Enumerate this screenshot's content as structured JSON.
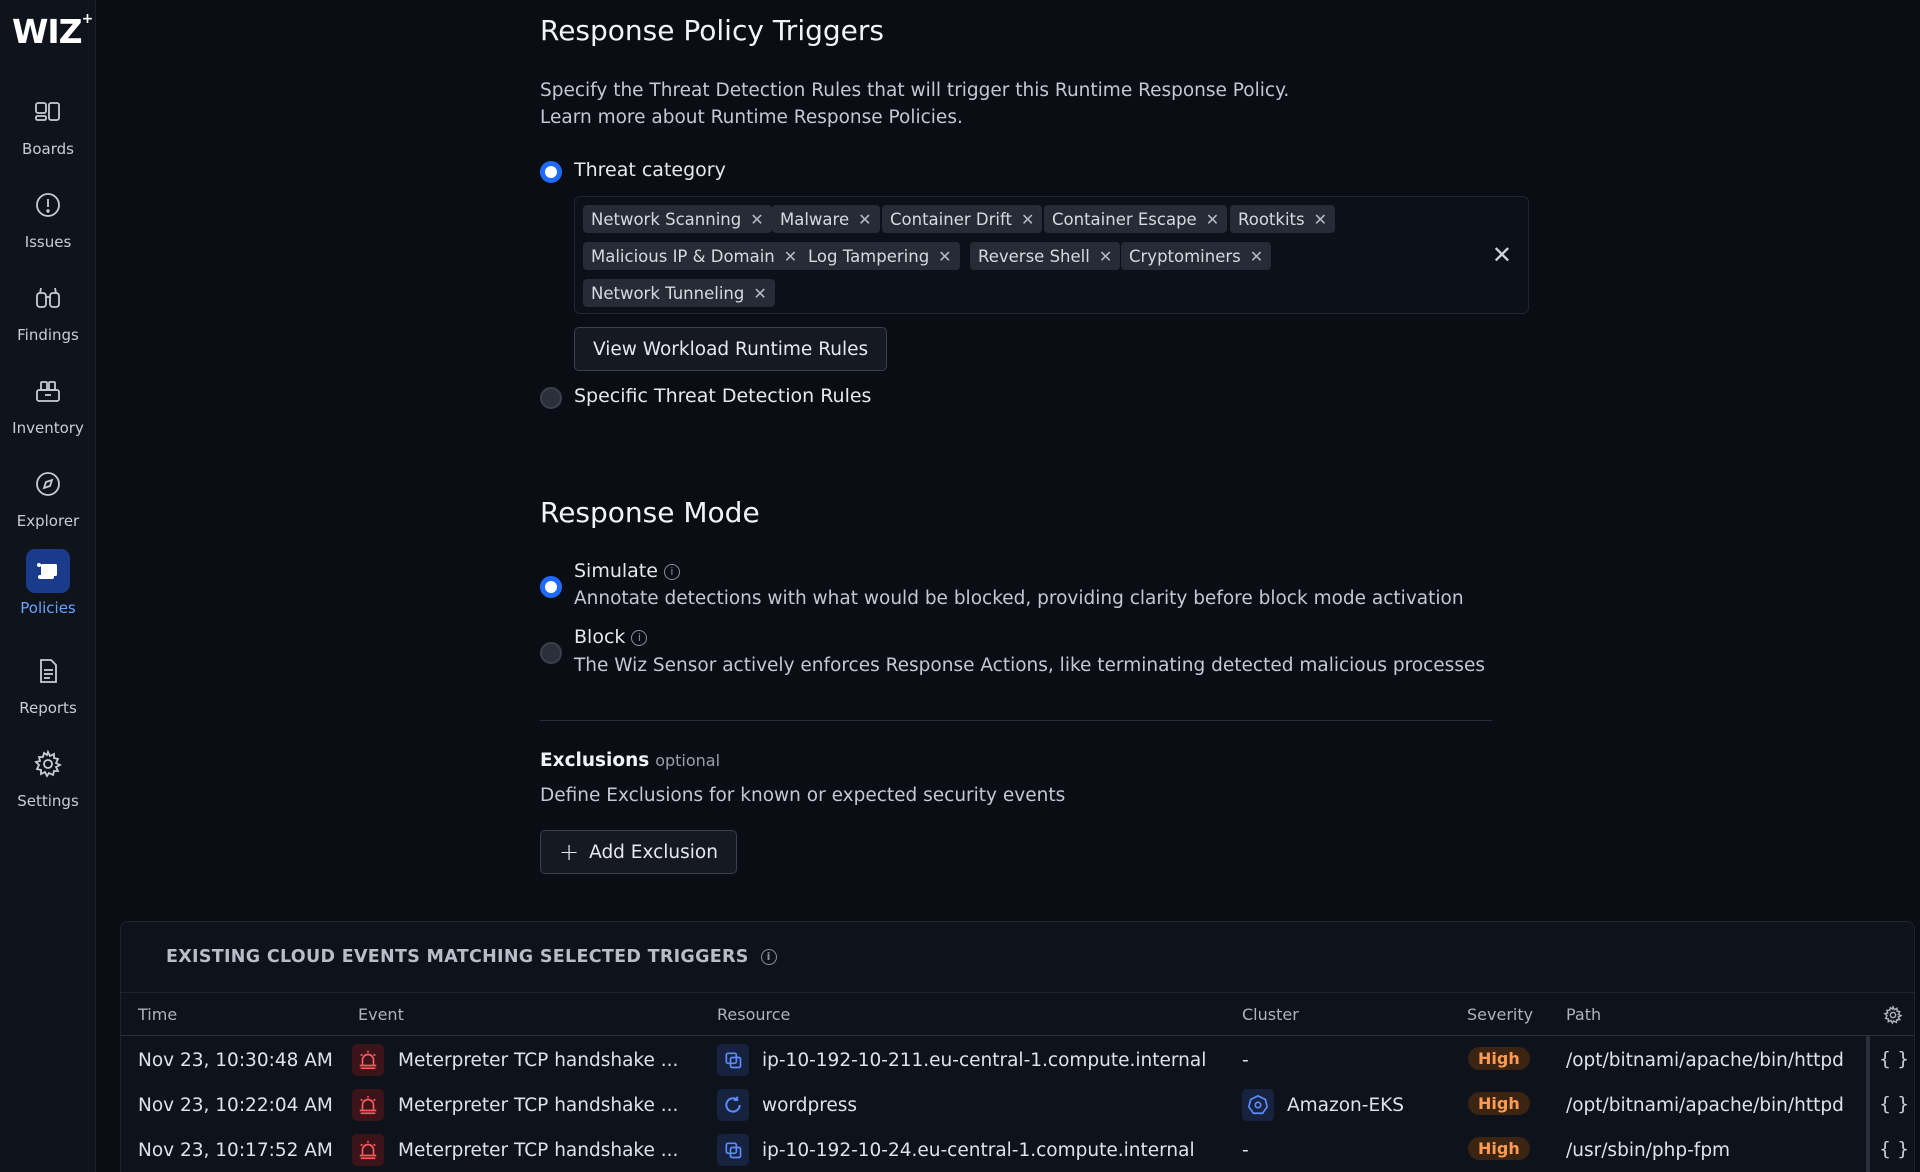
{
  "sidebar": {
    "logo": "WIZ",
    "logo_mark": "+",
    "items": [
      {
        "label": "Boards",
        "icon": "boards-icon"
      },
      {
        "label": "Issues",
        "icon": "issues-icon"
      },
      {
        "label": "Findings",
        "icon": "findings-icon"
      },
      {
        "label": "Inventory",
        "icon": "inventory-icon"
      },
      {
        "label": "Explorer",
        "icon": "explorer-icon"
      },
      {
        "label": "Policies",
        "icon": "policies-icon",
        "active": true
      },
      {
        "label": "Reports",
        "icon": "reports-icon"
      },
      {
        "label": "Settings",
        "icon": "settings-icon"
      }
    ]
  },
  "triggers": {
    "title": "Response Policy Triggers",
    "desc_line1": "Specify the Threat Detection Rules that will trigger this Runtime Response Policy.",
    "desc_line2": "Learn more about Runtime Response Policies.",
    "option_category": "Threat category",
    "tags": [
      "Network Scanning",
      "Malware",
      "Container Drift",
      "Container Escape",
      "Rootkits",
      "Malicious IP & Domain",
      "Log Tampering",
      "Reverse Shell",
      "Cryptominers",
      "Network Tunneling"
    ],
    "tag_remove": "✕",
    "clear_all": "✕",
    "view_rules_button": "View Workload Runtime Rules",
    "option_specific": "Specific Threat Detection Rules"
  },
  "response_mode": {
    "title": "Response Mode",
    "simulate_label": "Simulate",
    "simulate_desc": "Annotate detections with what would be blocked, providing clarity before block mode activation",
    "block_label": "Block",
    "block_desc": "The Wiz Sensor actively enforces Response Actions, like terminating detected malicious processes",
    "info_glyph": "i"
  },
  "exclusions": {
    "title": "Exclusions",
    "optional": "optional",
    "desc": "Define Exclusions for known or expected security events",
    "add_button": "Add Exclusion",
    "add_glyph": "+"
  },
  "events_table": {
    "title": "EXISTING CLOUD EVENTS MATCHING SELECTED TRIGGERS",
    "columns": {
      "time": "Time",
      "event": "Event",
      "resource": "Resource",
      "cluster": "Cluster",
      "severity": "Severity",
      "path": "Path"
    },
    "rows": [
      {
        "time": "Nov 23, 10:30:48 AM",
        "event": "Meterpreter TCP handshake ...",
        "resource": "ip-10-192-10-211.eu-central-1.compute.internal",
        "cluster": "-",
        "severity": "High",
        "path": "/opt/bitnami/apache/bin/httpd",
        "braces": "{ }"
      },
      {
        "time": "Nov 23, 10:22:04 AM",
        "event": "Meterpreter TCP handshake ...",
        "resource": "wordpress",
        "cluster": "Amazon-EKS",
        "severity": "High",
        "path": "/opt/bitnami/apache/bin/httpd",
        "braces": "{ }"
      },
      {
        "time": "Nov 23, 10:17:52 AM",
        "event": "Meterpreter TCP handshake ...",
        "resource": "ip-10-192-10-24.eu-central-1.compute.internal",
        "cluster": "-",
        "severity": "High",
        "path": "/usr/sbin/php-fpm",
        "braces": "{ }"
      }
    ]
  },
  "colors": {
    "accent": "#1f6bff",
    "severity_high": "#ff9b52",
    "active_nav": "#6aa4ff"
  }
}
